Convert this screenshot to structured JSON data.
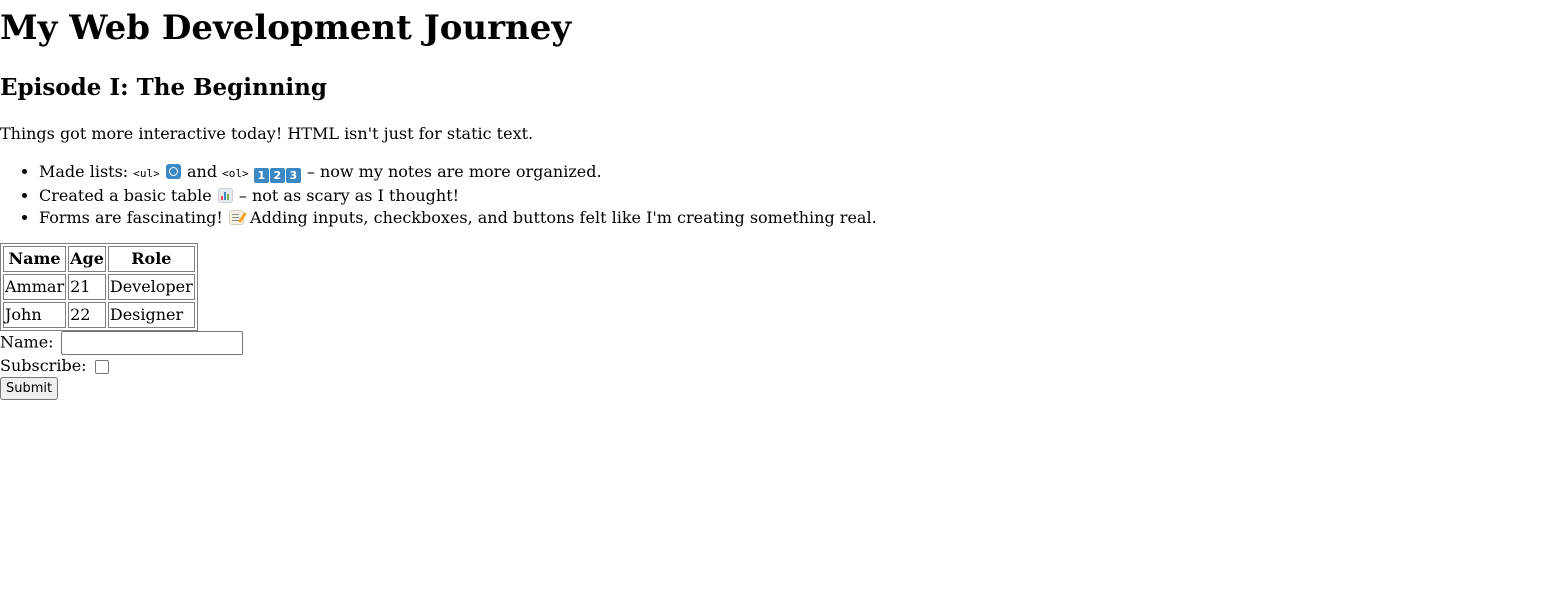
{
  "page": {
    "title": "My Web Development Journey",
    "episode_title": "Episode I: The Beginning",
    "intro": "Things got more interactive today! HTML isn't just for static text."
  },
  "notes": {
    "item1": {
      "prefix": "Made lists:",
      "ul_tag": "<ul>",
      "ul_icon": "record-button-icon",
      "and": "and",
      "ol_tag": "<ol>",
      "ol_keycaps": [
        "1",
        "2",
        "3"
      ],
      "suffix": "– now my notes are more organized."
    },
    "item2": {
      "prefix": "Created a basic table",
      "icon": "bar-chart-icon",
      "suffix": "– not as scary as I thought!"
    },
    "item3": {
      "prefix": "Forms are fascinating!",
      "icon": "memo-icon",
      "suffix": "Adding inputs, checkboxes, and buttons felt like I'm creating something real."
    }
  },
  "table": {
    "headers": [
      "Name",
      "Age",
      "Role"
    ],
    "rows": [
      [
        "Ammar",
        "21",
        "Developer"
      ],
      [
        "John",
        "22",
        "Designer"
      ]
    ]
  },
  "form": {
    "name_label": "Name:",
    "name_value": "",
    "subscribe_label": "Subscribe:",
    "subscribe_checked": false,
    "submit_label": "Submit"
  },
  "colors": {
    "keycap": "#3b88c3",
    "background": "#ffffff",
    "text": "#000000"
  }
}
